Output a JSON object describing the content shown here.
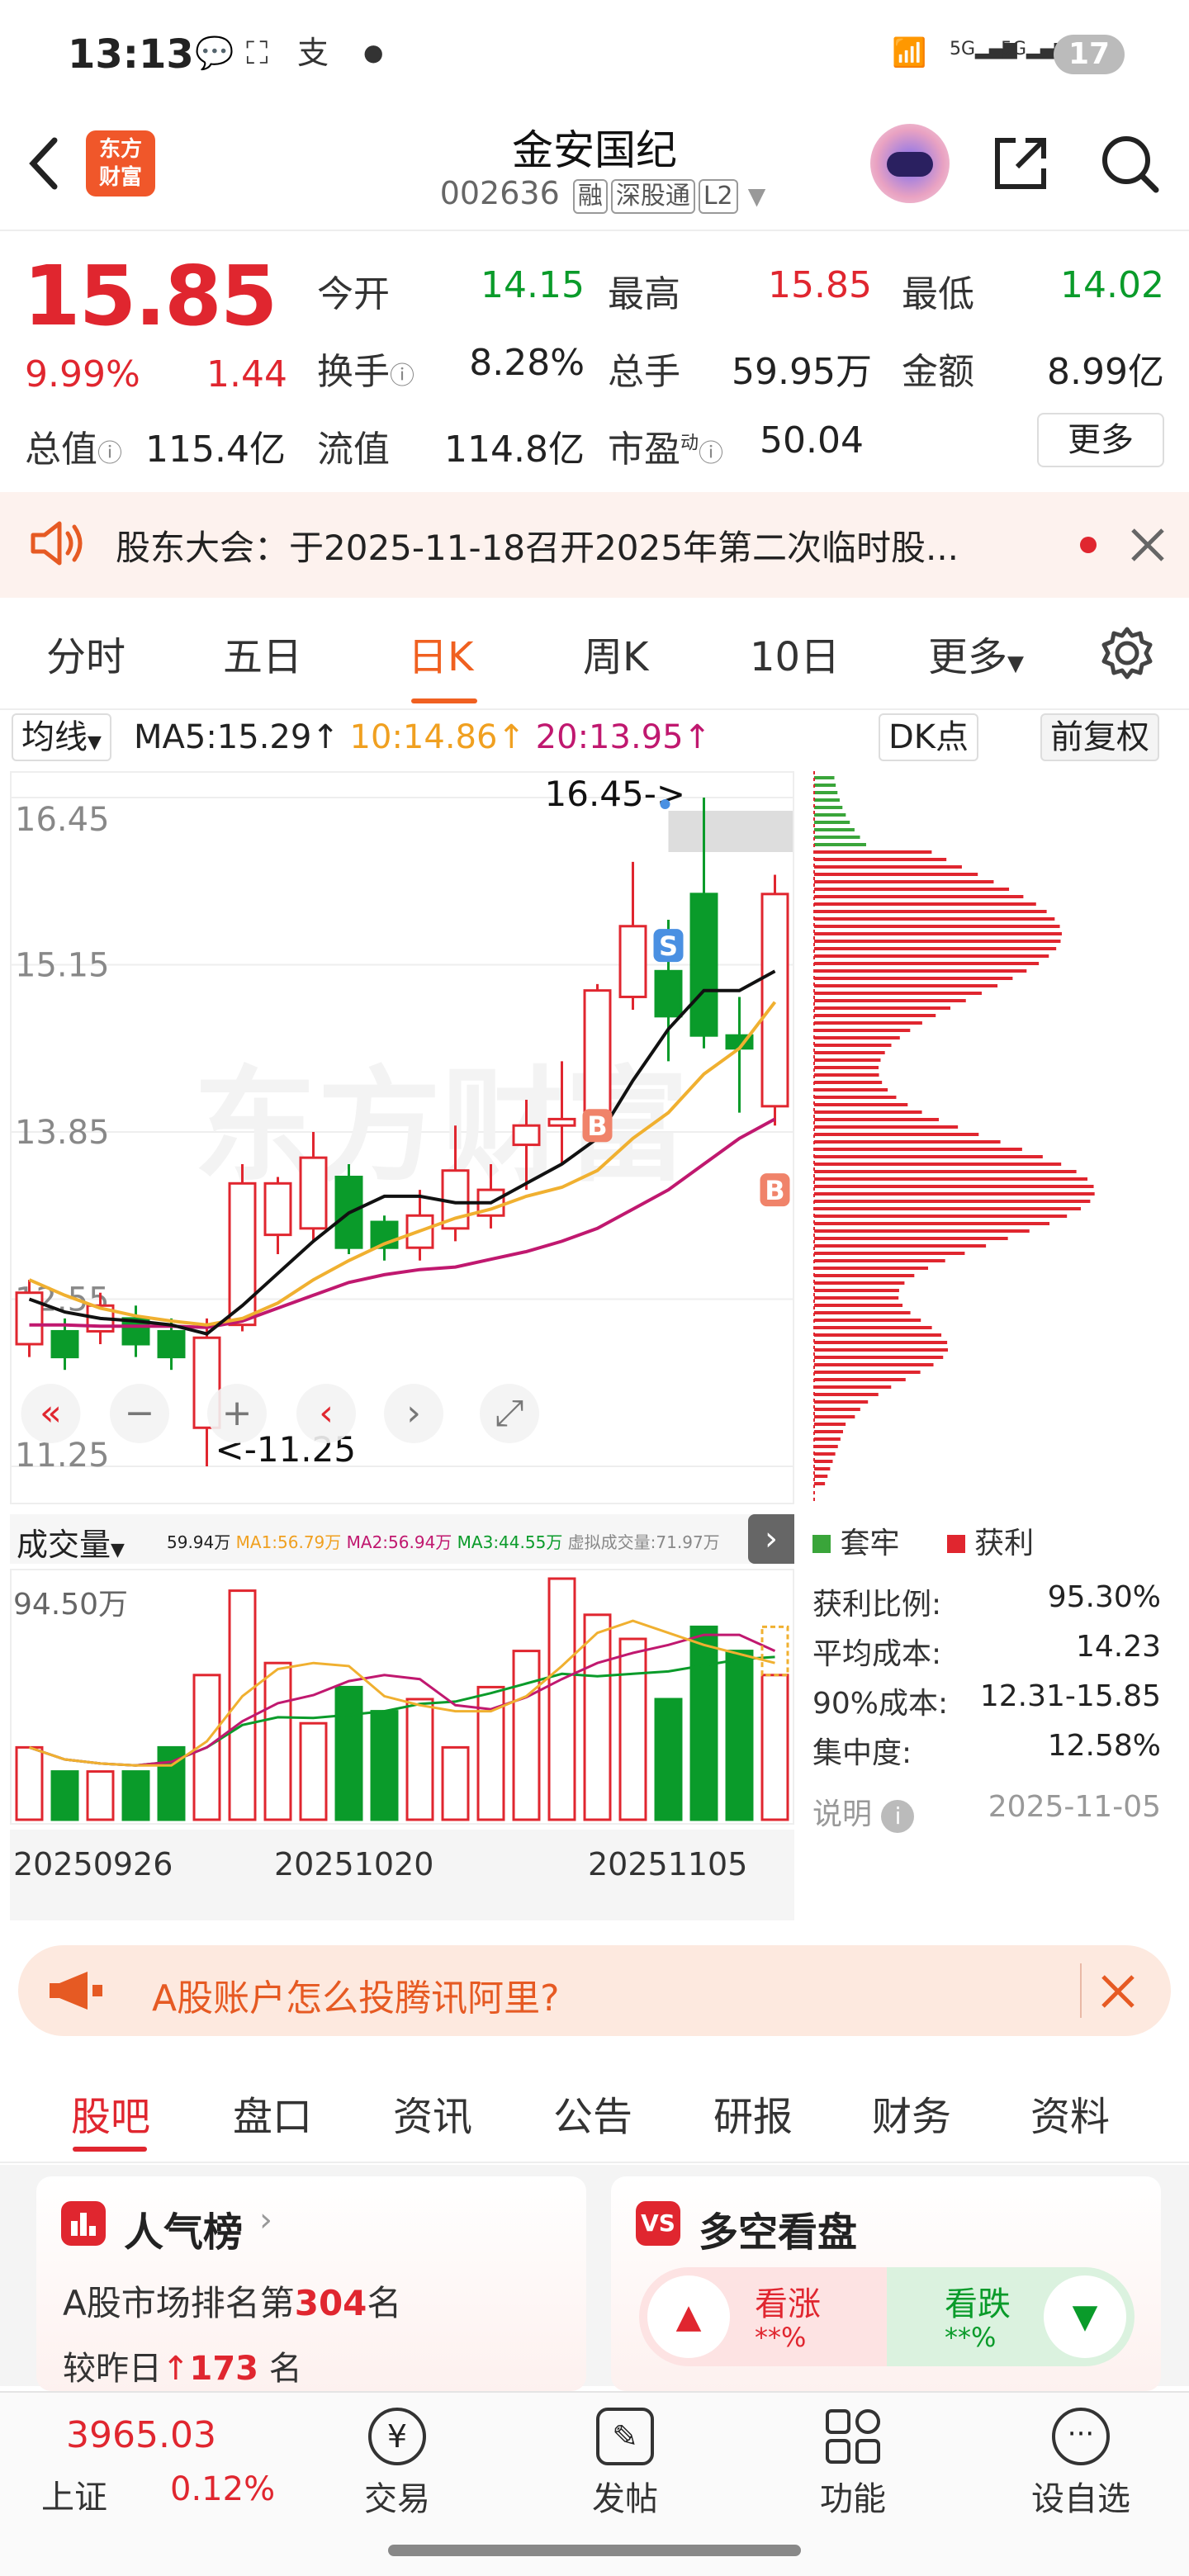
{
  "status_bar": {
    "time": "13:13",
    "network": "5G",
    "battery": "17"
  },
  "header": {
    "back_icon": "back-arrow-icon",
    "logo_text_1": "东方",
    "logo_text_2": "财富",
    "name": "金安国纪",
    "code": "002636",
    "tags": [
      "融",
      "深股通",
      "L2"
    ]
  },
  "quote": {
    "price": "15.85",
    "change_pct": "9.99%",
    "change_abs": "1.44",
    "labels": {
      "open": "今开",
      "high": "最高",
      "low": "最低",
      "turnover_rate": "换手",
      "volume": "总手",
      "amount": "金额",
      "total_cap": "总值",
      "float_cap": "流值",
      "pe": "市盈"
    },
    "values": {
      "open": "14.15",
      "high": "15.85",
      "low": "14.02",
      "turnover_rate": "8.28%",
      "volume": "59.95万",
      "amount": "8.99亿",
      "total_cap": "115.4亿",
      "float_cap": "114.8亿",
      "pe": "50.04"
    },
    "pe_superscript": "动",
    "more_label": "更多"
  },
  "notice": {
    "text": "股东大会：于2025-11-18召开2025年第二次临时股..."
  },
  "period_tabs": [
    "分时",
    "五日",
    "日K",
    "周K",
    "10日",
    "更多"
  ],
  "active_period": "日K",
  "chart_toolbar": {
    "indicator": "均线",
    "ma5": "MA5:15.29",
    "ma10": "10:14.86",
    "ma20": "20:13.95",
    "dk_label": "DK点",
    "adjust_label": "前复权"
  },
  "kline": {
    "y_ticks": [
      "16.45",
      "15.15",
      "13.85",
      "12.55",
      "11.25"
    ],
    "max_marker": "16.45->",
    "min_marker": "<-11.25",
    "signals": [
      "S",
      "B",
      "B"
    ]
  },
  "volume": {
    "indicator": "成交量",
    "legend": [
      "59.94万",
      "MA1:56.79万",
      "MA2:56.94万",
      "MA3:44.55万",
      "虚拟成交量:71.97万"
    ],
    "y_max": "94.50万",
    "dates": [
      "20250926",
      "20251020",
      "20251105"
    ]
  },
  "chips": {
    "legend_trapped": "套牢",
    "legend_profit": "获利",
    "stats": [
      {
        "label": "获利比例:",
        "value": "95.30%"
      },
      {
        "label": "平均成本:",
        "value": "14.23"
      },
      {
        "label": "90%成本:",
        "value": "12.31-15.85"
      },
      {
        "label": "集中度:",
        "value": "12.58%"
      },
      {
        "label": "说明",
        "value": "2025-11-05"
      }
    ]
  },
  "ad": {
    "text": "A股账户怎么投腾讯阿里?"
  },
  "main_tabs": [
    "股吧",
    "盘口",
    "资讯",
    "公告",
    "研报",
    "财务",
    "资料"
  ],
  "active_main_tab": "股吧",
  "cards": {
    "popularity": {
      "title": "人气榜",
      "rank_prefix": "A股市场排名第",
      "rank": "304",
      "rank_suffix": "名",
      "compare_prefix": "较昨日",
      "compare_value": "173",
      "compare_suffix": "名"
    },
    "bull_bear": {
      "title": "多空看盘",
      "up_label": "看涨",
      "up_value": "**%",
      "down_label": "看跌",
      "down_value": "**%"
    }
  },
  "bottom_nav": {
    "index_value": "3965.03",
    "index_name": "上证",
    "index_change": "0.12%",
    "items": [
      "交易",
      "发帖",
      "功能",
      "设自选"
    ]
  },
  "colors": {
    "up": "#e0262f",
    "down": "#0a9b2a",
    "accent": "#f06020"
  },
  "chart_data": {
    "type": "candlestick",
    "ylim": [
      11.25,
      16.45
    ],
    "candles": [
      {
        "o": 12.2,
        "c": 12.6,
        "h": 12.7,
        "l": 12.1
      },
      {
        "o": 12.3,
        "c": 12.1,
        "h": 12.4,
        "l": 12.0
      },
      {
        "o": 12.3,
        "c": 12.5,
        "h": 12.6,
        "l": 12.2
      },
      {
        "o": 12.4,
        "c": 12.2,
        "h": 12.5,
        "l": 12.1
      },
      {
        "o": 12.3,
        "c": 12.1,
        "h": 12.4,
        "l": 12.0
      },
      {
        "o": 11.55,
        "c": 12.25,
        "h": 12.4,
        "l": 11.25
      },
      {
        "o": 12.35,
        "c": 13.45,
        "h": 13.6,
        "l": 12.3
      },
      {
        "o": 13.05,
        "c": 13.45,
        "h": 13.5,
        "l": 12.9
      },
      {
        "o": 13.1,
        "c": 13.65,
        "h": 13.85,
        "l": 13.0
      },
      {
        "o": 13.5,
        "c": 12.95,
        "h": 13.6,
        "l": 12.9
      },
      {
        "o": 13.15,
        "c": 12.95,
        "h": 13.2,
        "l": 12.85
      },
      {
        "o": 12.95,
        "c": 13.2,
        "h": 13.4,
        "l": 12.85
      },
      {
        "o": 13.1,
        "c": 13.55,
        "h": 13.9,
        "l": 13.0
      },
      {
        "o": 13.2,
        "c": 13.4,
        "h": 13.6,
        "l": 13.1
      },
      {
        "o": 13.75,
        "c": 13.9,
        "h": 14.1,
        "l": 13.4
      },
      {
        "o": 13.9,
        "c": 13.95,
        "h": 14.4,
        "l": 13.6
      },
      {
        "o": 13.95,
        "c": 14.95,
        "h": 15.0,
        "l": 13.8
      },
      {
        "o": 14.9,
        "c": 15.45,
        "h": 15.95,
        "l": 14.8
      },
      {
        "o": 15.1,
        "c": 14.75,
        "h": 15.5,
        "l": 14.4
      },
      {
        "o": 15.7,
        "c": 14.6,
        "h": 16.45,
        "l": 14.5
      },
      {
        "o": 14.6,
        "c": 14.5,
        "h": 14.9,
        "l": 14.0
      },
      {
        "o": 14.05,
        "c": 15.7,
        "h": 15.85,
        "l": 13.9
      }
    ],
    "ma5": [
      12.55,
      12.45,
      12.4,
      12.38,
      12.35,
      12.28,
      12.5,
      12.75,
      13.0,
      13.22,
      13.35,
      13.35,
      13.3,
      13.3,
      13.45,
      13.6,
      13.8,
      14.25,
      14.65,
      14.95,
      14.95,
      15.1
    ],
    "ma10": [
      12.7,
      12.58,
      12.48,
      12.42,
      12.38,
      12.35,
      12.4,
      12.52,
      12.7,
      12.85,
      12.98,
      13.08,
      13.18,
      13.25,
      13.35,
      13.42,
      13.55,
      13.8,
      14.0,
      14.3,
      14.5,
      14.86
    ],
    "ma20": [
      12.35,
      12.35,
      12.34,
      12.34,
      12.34,
      12.33,
      12.38,
      12.48,
      12.58,
      12.68,
      12.74,
      12.78,
      12.8,
      12.86,
      12.92,
      13.0,
      13.1,
      13.25,
      13.4,
      13.6,
      13.8,
      13.95
    ],
    "volumes": [
      30,
      20,
      20,
      20,
      30,
      60,
      95,
      65,
      40,
      55,
      45,
      50,
      30,
      55,
      70,
      100,
      85,
      75,
      50,
      80,
      70,
      60
    ]
  }
}
